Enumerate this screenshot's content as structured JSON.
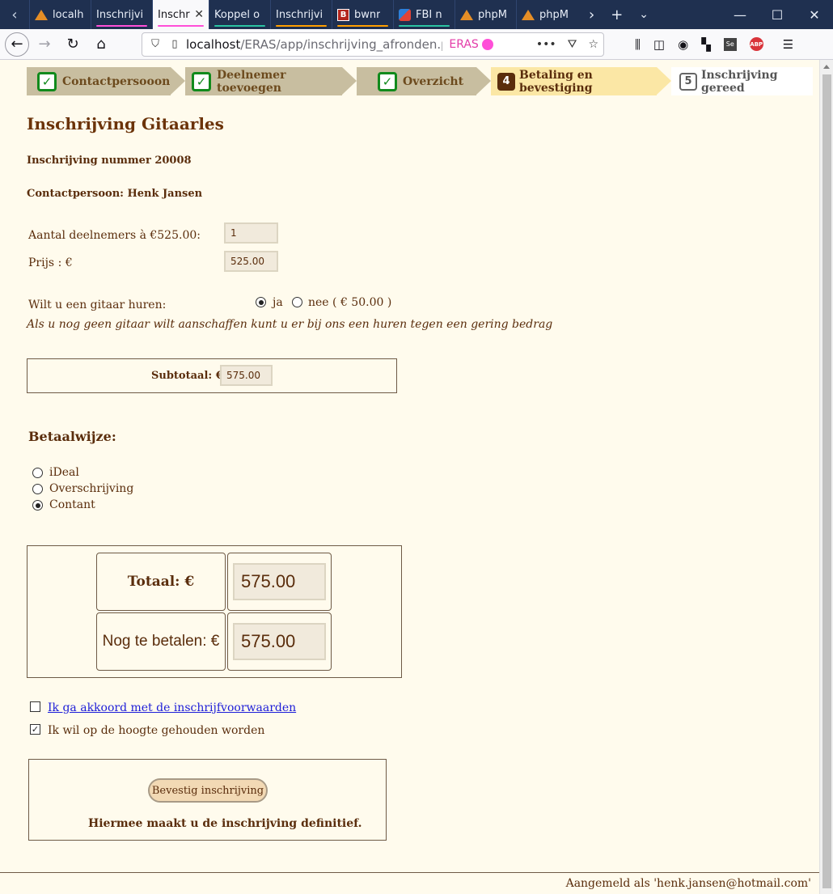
{
  "browser": {
    "tabs": [
      {
        "label": "localh",
        "icon": "m"
      },
      {
        "label": "Inschrijvi",
        "icon": "none",
        "underline": "#ff4fd8"
      },
      {
        "label": "Inschr",
        "icon": "none",
        "active": true,
        "underline": "#ff4fd8"
      },
      {
        "label": "Koppel o",
        "icon": "none",
        "underline": "#2ac3a2"
      },
      {
        "label": "Inschrijvi",
        "icon": "none",
        "underline": "#ff9f00"
      },
      {
        "label": "bwnr",
        "icon": "b",
        "underline": "#ff9f00"
      },
      {
        "label": "FBI n",
        "icon": "f",
        "underline": "#2ac3a2"
      },
      {
        "label": "phpM",
        "icon": "m"
      },
      {
        "label": "phpM",
        "icon": "m"
      }
    ],
    "url_host": "localhost",
    "url_path": "/ERAS/app/inschrijving_afronden.php?e",
    "url_tag": "ERAS"
  },
  "steps": [
    {
      "label": "Contactpersooon",
      "state": "done"
    },
    {
      "label": "Deelnemer toevoegen",
      "state": "done"
    },
    {
      "label": "Overzicht",
      "state": "done"
    },
    {
      "label": "Betaling en bevestiging",
      "state": "current",
      "num": "4"
    },
    {
      "label": "Inschrijving gereed",
      "state": "todo",
      "num": "5"
    }
  ],
  "page": {
    "title": "Inschrijving Gitaarles",
    "reg_number": "Inschrijving nummer 20008",
    "contact": "Contactpersoon: Henk Jansen",
    "participants_label": "Aantal deelnemers à €525.00:",
    "participants_value": "1",
    "price_label": "Prijs : €",
    "price_value": "525.00",
    "rent_question": "Wilt u een gitaar huren:",
    "rent_yes": "ja",
    "rent_no": "nee ( € 50.00 )",
    "rent_selected": "ja",
    "rent_note": "Als u nog geen gitaar wilt aanschaffen kunt u er bij ons een huren tegen een gering bedrag",
    "subtotal_label": "Subtotaal: €",
    "subtotal_value": "575.00",
    "payment_heading": "Betaalwijze:",
    "payment_options": [
      "iDeal",
      "Overschrijving",
      "Contant"
    ],
    "payment_selected": "Contant",
    "total_label": "Totaal: €",
    "total_value": "575.00",
    "due_label": "Nog te betalen: €",
    "due_value": "575.00",
    "terms_link": "Ik ga akkoord met de inschrijfvoorwaarden",
    "terms_checked": false,
    "newsletter_label": "Ik wil op de hoogte gehouden worden",
    "newsletter_checked": true,
    "confirm_button": "Bevestig inschrijving",
    "confirm_note": "Hiermee maakt u de inschrijving definitief.",
    "logged_in": "Aangemeld als 'henk.jansen@hotmail.com'"
  }
}
